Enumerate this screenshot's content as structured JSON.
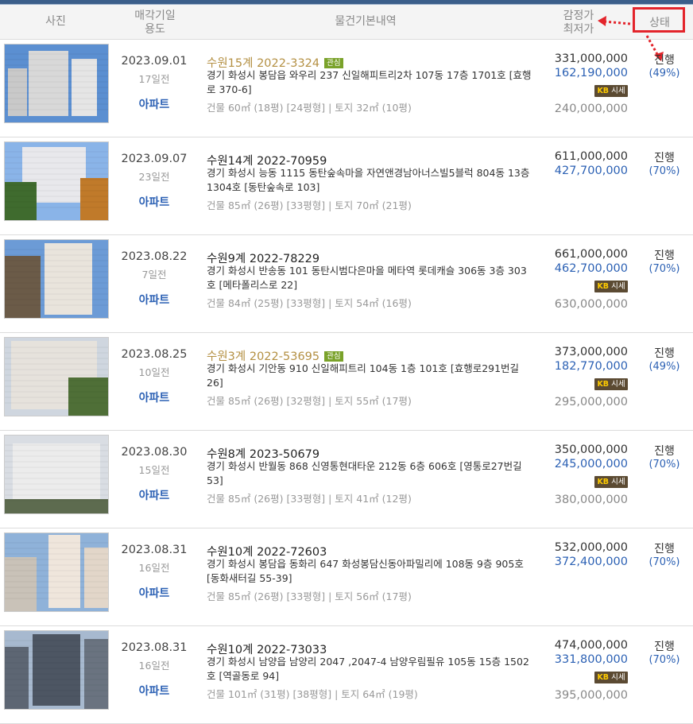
{
  "header": {
    "photo": "사진",
    "date_line1": "매각기일",
    "date_line2": "용도",
    "info": "물건기본내역",
    "price_line1": "감정가",
    "price_line2": "최저가",
    "status": "상태"
  },
  "market_badge": "시세",
  "market_badge_kb": "KB",
  "fav_badge": "관심",
  "colors": {
    "accent_red": "#e3242b",
    "link_blue": "#2c61b4",
    "fav_gold": "#b49043"
  },
  "rows": [
    {
      "date": "2023.09.01",
      "ago": "17일전",
      "kind": "아파트",
      "case": "수원15계 2022-3324",
      "fav": true,
      "address": "경기 화성시 봉담읍 와우리 237 신일해피트리2차 107동 17층 1701호 [효행로 370-6]",
      "area": "건물 60㎡ (18평) [24평형]  |  토지 32㎡ (10평)",
      "appraisal": "331,000,000",
      "min_price": "162,190,000",
      "market": true,
      "sale": "240,000,000",
      "status": "진행",
      "pct": "(49%)"
    },
    {
      "date": "2023.09.07",
      "ago": "23일전",
      "kind": "아파트",
      "case": "수원14계 2022-70959",
      "fav": false,
      "address": "경기 화성시 능동 1115 동탄숲속마을 자연앤경남아너스빌5블럭 804동 13층 1304호 [동탄숲속로 103]",
      "area": "건물 85㎡ (26평) [33평형]  |  토지 70㎡ (21평)",
      "appraisal": "611,000,000",
      "min_price": "427,700,000",
      "market": false,
      "sale": "",
      "status": "진행",
      "pct": "(70%)"
    },
    {
      "date": "2023.08.22",
      "ago": "7일전",
      "kind": "아파트",
      "case": "수원9계 2022-78229",
      "fav": false,
      "address": "경기 화성시 반송동 101 동탄시범다은마을 메타역 롯데캐슬 306동 3층 303호 [메타폴리스로 22]",
      "area": "건물 84㎡ (25평) [33평형]  |  토지 54㎡ (16평)",
      "appraisal": "661,000,000",
      "min_price": "462,700,000",
      "market": true,
      "sale": "630,000,000",
      "status": "진행",
      "pct": "(70%)"
    },
    {
      "date": "2023.08.25",
      "ago": "10일전",
      "kind": "아파트",
      "case": "수원3계 2022-53695",
      "fav": true,
      "address": "경기 화성시 기안동 910 신일해피트리 104동 1층 101호 [효행로291번길 26]",
      "area": "건물 85㎡ (26평) [32평형]  |  토지 55㎡ (17평)",
      "appraisal": "373,000,000",
      "min_price": "182,770,000",
      "market": true,
      "sale": "295,000,000",
      "status": "진행",
      "pct": "(49%)"
    },
    {
      "date": "2023.08.30",
      "ago": "15일전",
      "kind": "아파트",
      "case": "수원8계 2023-50679",
      "fav": false,
      "address": "경기 화성시 반월동 868 신영통현대타운 212동 6층 606호 [영통로27번길 53]",
      "area": "건물 85㎡ (26평) [33평형]  |  토지 41㎡ (12평)",
      "appraisal": "350,000,000",
      "min_price": "245,000,000",
      "market": true,
      "sale": "380,000,000",
      "status": "진행",
      "pct": "(70%)"
    },
    {
      "date": "2023.08.31",
      "ago": "16일전",
      "kind": "아파트",
      "case": "수원10계 2022-72603",
      "fav": false,
      "address": "경기 화성시 봉담읍 동화리 647 화성봉담신동아파밀리에 108동 9층 905호 [동화새터길 55-39]",
      "area": "건물 85㎡ (26평) [33평형]  |  토지 56㎡ (17평)",
      "appraisal": "532,000,000",
      "min_price": "372,400,000",
      "market": false,
      "sale": "",
      "status": "진행",
      "pct": "(70%)"
    },
    {
      "date": "2023.08.31",
      "ago": "16일전",
      "kind": "아파트",
      "case": "수원10계 2022-73033",
      "fav": false,
      "address": "경기 화성시 남양읍 남양리 2047 ,2047-4 남양우림필유 105동 15층 1502호 [역골동로 94]",
      "area": "건물 101㎡ (31평) [38평형]  |  토지 64㎡ (19평)",
      "appraisal": "474,000,000",
      "min_price": "331,800,000",
      "market": true,
      "sale": "395,000,000",
      "status": "진행",
      "pct": "(70%)"
    }
  ]
}
